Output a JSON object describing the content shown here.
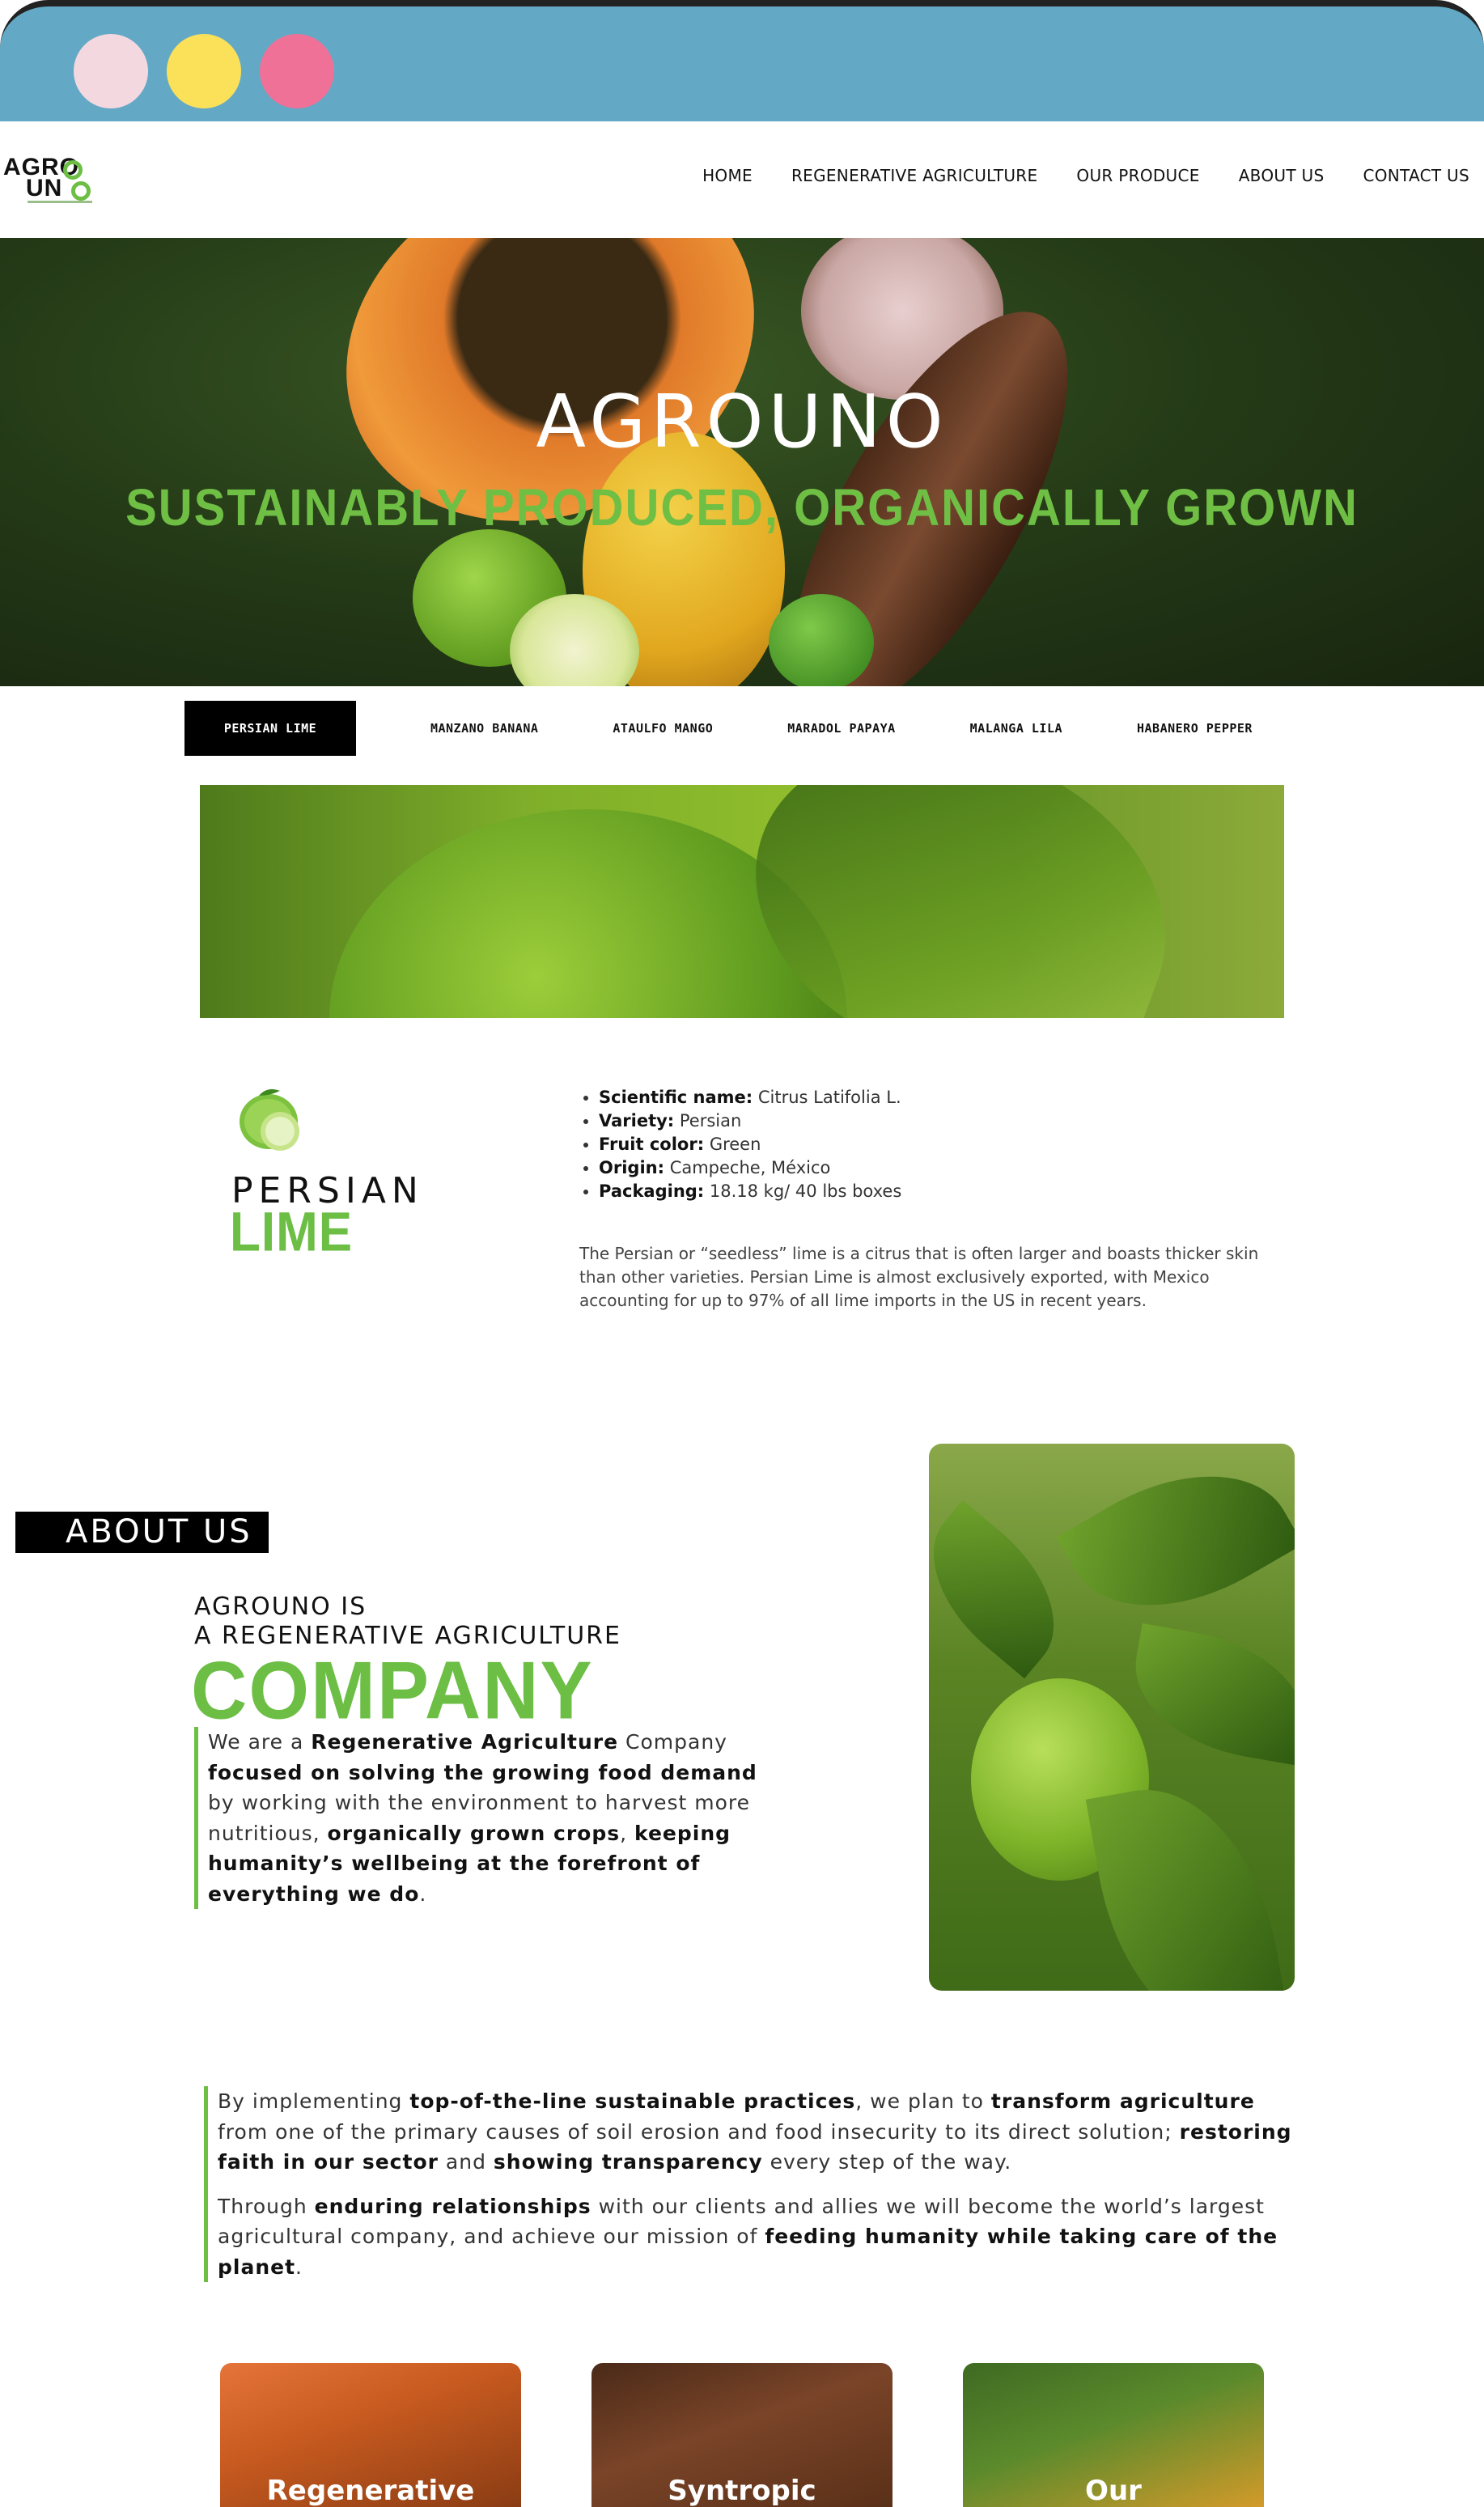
{
  "colors": {
    "chrome_bg": "#63a9c5",
    "dot_1": "#f4d8e0",
    "dot_2": "#fbe05a",
    "dot_3": "#ef7197",
    "accent_green": "#6cbe45"
  },
  "logo": {
    "line1": "AGRO",
    "line2": "UN"
  },
  "nav": {
    "items": [
      "HOME",
      "REGENERATIVE AGRICULTURE",
      "OUR PRODUCE",
      "ABOUT US",
      "CONTACT US"
    ]
  },
  "hero": {
    "title": "AGROUNO",
    "subtitle": "SUSTAINABLY PRODUCED, ORGANICALLY GROWN"
  },
  "tabs": {
    "items": [
      "PERSIAN LIME",
      "MANZANO BANANA",
      "ATAULFO MANGO",
      "MARADOL PAPAYA",
      "MALANGA LILA",
      "HABANERO PEPPER"
    ],
    "active": "PERSIAN LIME"
  },
  "product": {
    "name_line1": "PERSIAN",
    "name_line2": "LIME",
    "icon": "lime-icon",
    "specs": [
      {
        "label": "Scientific name:",
        "value": "Citrus Latifolia L."
      },
      {
        "label": "Variety:",
        "value": "Persian"
      },
      {
        "label": "Fruit color:",
        "value": "Green"
      },
      {
        "label": "Origin:",
        "value": "Campeche, México"
      },
      {
        "label": "Packaging:",
        "value": "18.18 kg/ 40 lbs boxes"
      }
    ],
    "description": "The Persian or “seedless” lime is a citrus that is often larger and boasts thicker skin than other varieties. Persian Lime is almost exclusively exported, with Mexico accounting for up to 97% of all lime imports in the US in recent years."
  },
  "about": {
    "badge": "ABOUT US",
    "line1": "AGROUNO IS",
    "line2": "A REGENERATIVE AGRICULTURE",
    "company": "COMPANY",
    "text": [
      {
        "t": "We are a ",
        "b": false
      },
      {
        "t": "Regenerative Agriculture",
        "b": true
      },
      {
        "t": " Company ",
        "b": false
      },
      {
        "t": "focused on solving the growing food demand",
        "b": true
      },
      {
        "t": " by working with the environment to harvest more nutritious, ",
        "b": false
      },
      {
        "t": "organically grown crops",
        "b": true
      },
      {
        "t": ", ",
        "b": false
      },
      {
        "t": "keeping humanity’s wellbeing at the forefront of everything we do",
        "b": true
      },
      {
        "t": ".",
        "b": false
      }
    ]
  },
  "implement": {
    "p1": [
      {
        "t": "By implementing ",
        "b": false
      },
      {
        "t": "top-of-the-line sustainable practices",
        "b": true
      },
      {
        "t": ", we plan to ",
        "b": false
      },
      {
        "t": "transform agriculture",
        "b": true
      },
      {
        "t": " from one of the primary causes of soil erosion and food insecurity to its direct solution; ",
        "b": false
      },
      {
        "t": "restoring faith in our sector",
        "b": true
      },
      {
        "t": " and ",
        "b": false
      },
      {
        "t": "showing transparency",
        "b": true
      },
      {
        "t": " every step of the way.",
        "b": false
      }
    ],
    "p2": [
      {
        "t": "Through ",
        "b": false
      },
      {
        "t": "enduring relationships",
        "b": true
      },
      {
        "t": " with our clients and allies we will become the world’s largest agricultural company, and achieve our mission of ",
        "b": false
      },
      {
        "t": "feeding humanity while taking care of the planet",
        "b": true
      },
      {
        "t": ".",
        "b": false
      }
    ]
  },
  "cards": [
    "Regenerative",
    "Syntropic",
    "Our"
  ]
}
